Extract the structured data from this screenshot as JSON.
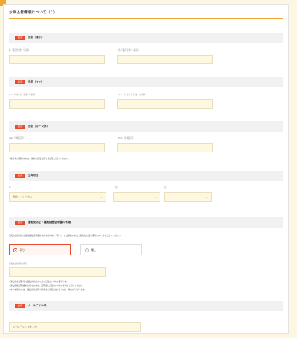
{
  "title": "お申込者情報について（1）",
  "badge": "必須",
  "sections": {
    "kanji": "氏名（漢字）",
    "kana": "氏名（カナ）",
    "romaji": "氏名（ローマ字）",
    "dob": "生年月日",
    "license": "運転免許証・運転経歴証明書の有無",
    "email": "メールアドレス"
  },
  "fields": {
    "sei_kanji": {
      "label": "姓（漢字全角）（必須）",
      "placeholder": ""
    },
    "mei_kanji": {
      "label": "名（漢字全角）（必須）",
      "placeholder": ""
    },
    "sei_kana": {
      "label": "セイ（カタカナ全角）（必須）",
      "placeholder": ""
    },
    "mei_kana": {
      "label": "メイ（カタカナ全角）（必須）",
      "placeholder": ""
    },
    "last_roman": {
      "label": "Last（半角英字）",
      "placeholder": ""
    },
    "first_roman": {
      "label": "First（半角英字）",
      "placeholder": ""
    },
    "license_no": {
      "label": "運転免許証等の番号",
      "placeholder": ""
    },
    "email": {
      "label": "",
      "placeholder": "メールアドレスを入力"
    }
  },
  "romaji_note": "※旅券をご登録の方は、旅券の記載と同じ表記でご記入ください。",
  "dob": {
    "year_label": "年",
    "month_label": "月",
    "day_label": "日",
    "year_value": "選択してください",
    "month_value": "",
    "day_value": ""
  },
  "license": {
    "question": "運転免許証または運転経歴証明書をお持ちですか。「有り」をご選択の方は、運転免許証の番号についてもご記入ください。",
    "option_yes": "有り",
    "option_no": "無し",
    "notes": [
      "※運転免許証番号は運転免許証の右上に記載の12桁の番号です。",
      "※運転経歴証明書をお持ちの方は、証明書に記載の12桁の番号をご記入ください。",
      "※本人確認のため、運転免許証等の情報をご確認させていただく場合がございます。"
    ]
  },
  "icons": {
    "select_arrow": "chevron-down-icon"
  },
  "colors": {
    "accent": "#f0a830",
    "required": "#e74c2e",
    "input_bg": "#fff8e1"
  }
}
